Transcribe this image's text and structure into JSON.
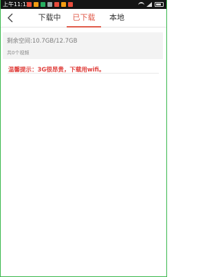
{
  "status_bar": {
    "time": "上午11:12",
    "notification_icons": [
      {
        "name": "app-icon-1",
        "color": "#e74c3c"
      },
      {
        "name": "app-icon-2",
        "color": "#f39c12"
      },
      {
        "name": "app-icon-3",
        "color": "#27ae60"
      },
      {
        "name": "app-icon-4",
        "color": "#95a5a6"
      },
      {
        "name": "app-icon-5",
        "color": "#e74c3c"
      },
      {
        "name": "app-icon-6",
        "color": "#f39c12"
      },
      {
        "name": "app-icon-7",
        "color": "#e74c3c"
      }
    ]
  },
  "header": {
    "back_icon": "chevron-left-icon",
    "tabs": [
      {
        "label": "下载中",
        "active": false
      },
      {
        "label": "已下载",
        "active": true
      },
      {
        "label": "本地",
        "active": false
      }
    ]
  },
  "storage": {
    "space_text": "剩余空间:10.7GB/12.7GB",
    "video_count_text": "共0个视频"
  },
  "tip": "温馨提示：3G很昂贵，下载用wifi。",
  "colors": {
    "accent": "#e05a49",
    "tip": "#e0403d",
    "frame": "#37b64a"
  }
}
